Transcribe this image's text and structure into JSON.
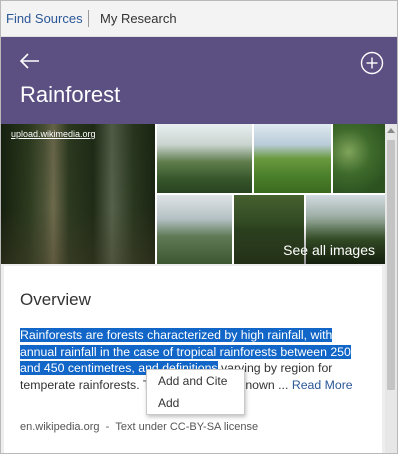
{
  "tabs": {
    "find_sources": "Find Sources",
    "my_research": "My Research"
  },
  "header": {
    "title": "Rainforest",
    "back_icon": "back-arrow-icon",
    "add_icon": "plus-circle-icon",
    "background_color": "#5c4f82"
  },
  "images": {
    "credit": "upload.wikimedia.org",
    "see_all_label": "See all images"
  },
  "overview": {
    "title": "Overview",
    "text_selected": "Rainforests are forests characterized by high rainfall, with annual rainfall in the case of tropical rainforests between 250 and 450 centimetres, and definitions",
    "text_rest": " varying by region for temperate rainforests. The monsoo",
    "text_hidden_tail": "ively known ... ",
    "read_more": "Read More",
    "source": "en.wikipedia.org",
    "separator": "-",
    "license": "Text under CC-BY-SA license",
    "highlight_color": "#1266c8"
  },
  "context_menu": {
    "items": [
      "Add and Cite",
      "Add"
    ]
  }
}
